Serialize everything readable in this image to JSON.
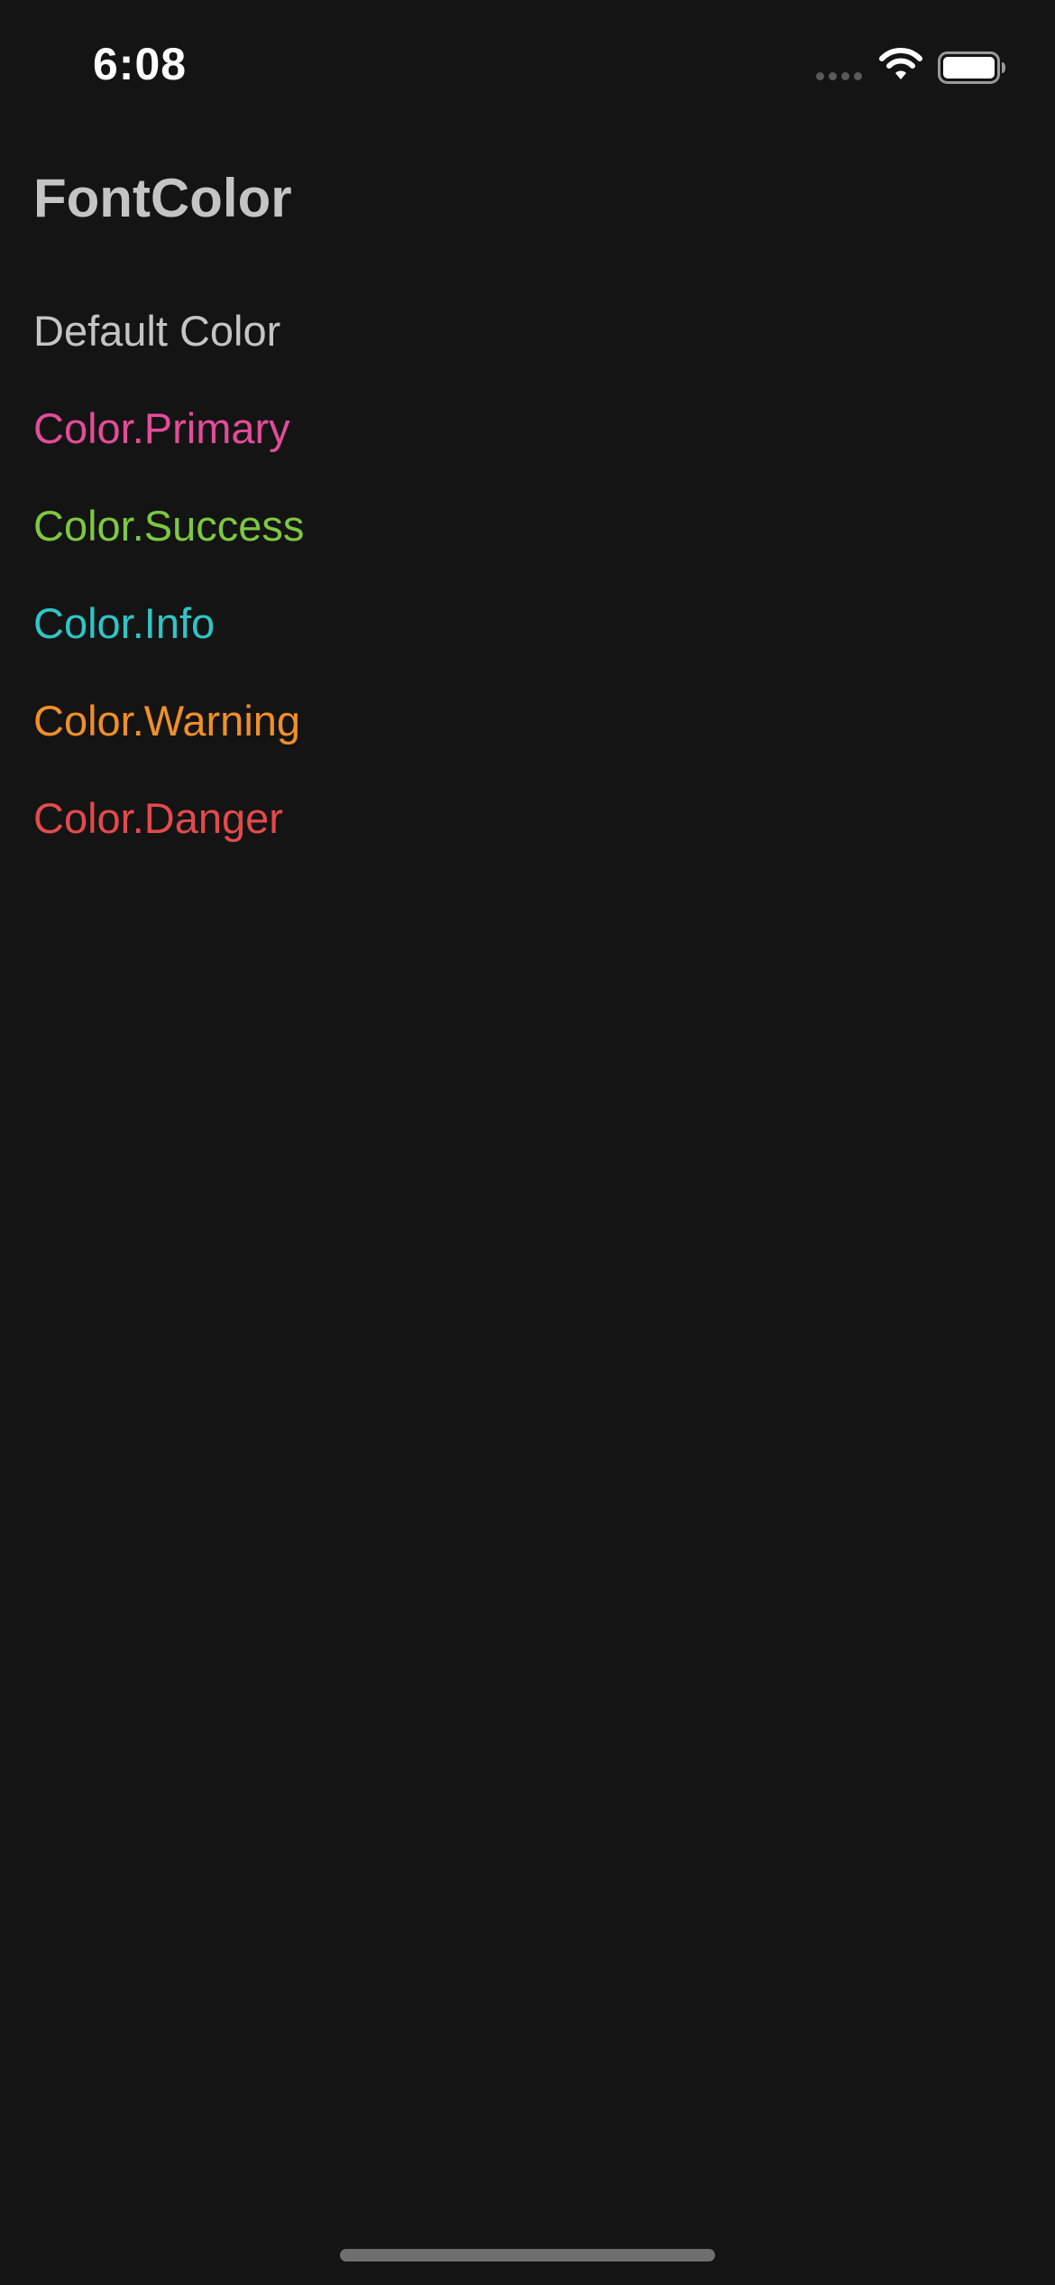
{
  "status_bar": {
    "time": "6:08"
  },
  "header": {
    "title": "FontColor"
  },
  "colors": {
    "default": "#c4c4c4",
    "primary": "#e34c98",
    "success": "#7ec840",
    "info": "#2fc5c7",
    "warning": "#f08f29",
    "danger": "#e44a4c"
  },
  "list": {
    "items": [
      {
        "label": "Default Color",
        "color": "#c4c4c4"
      },
      {
        "label": "Color.Primary",
        "color": "#e34c98"
      },
      {
        "label": "Color.Success",
        "color": "#7ec840"
      },
      {
        "label": "Color.Info",
        "color": "#2fc5c7"
      },
      {
        "label": "Color.Warning",
        "color": "#f08f29"
      },
      {
        "label": "Color.Danger",
        "color": "#e44a4c"
      }
    ]
  },
  "icons": {
    "signal": "cellular-signal-icon",
    "wifi": "wifi-icon",
    "battery": "battery-icon"
  }
}
